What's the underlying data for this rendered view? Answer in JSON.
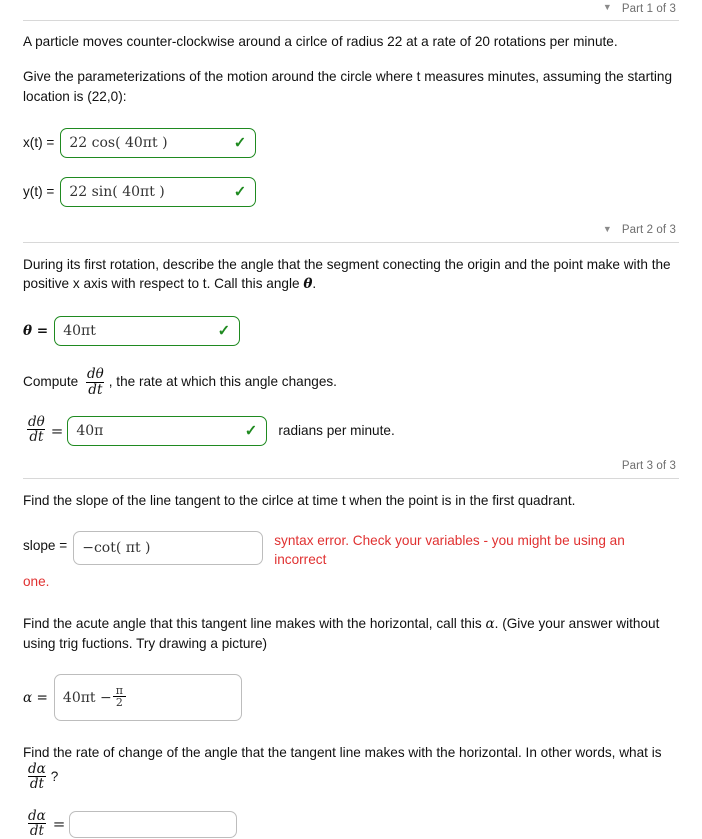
{
  "parts": {
    "part1": {
      "caret": "▼",
      "label": "Part 1 of 3"
    },
    "part2": {
      "caret": "▼",
      "label": "Part 2 of 3"
    },
    "part3": {
      "label": "Part 3 of 3"
    }
  },
  "section1": {
    "intro": "A particle moves counter-clockwise around a cirlce of radius 22 at a rate of 20 rotations per minute.",
    "instruction": "Give the parameterizations of the motion around the circle where t measures minutes, assuming the starting location is (22,0):",
    "x_label": "x(t) =",
    "x_value": "22 cos( 40πt )",
    "x_status": "✓",
    "y_label": "y(t) =",
    "y_value": "22 sin( 40πt )",
    "y_status": "✓"
  },
  "section2": {
    "prompt_a": "During its first rotation, describe the angle that the segment conecting the origin and the point make with the positive x axis with respect to t. Call this angle",
    "prompt_a_symbol": "θ",
    "prompt_a_end": ".",
    "theta_label": "θ =",
    "theta_value": "40πt",
    "theta_status": "✓",
    "compute_pre": "Compute",
    "compute_frac_num": "dθ",
    "compute_frac_den": "dt",
    "compute_post": ", the rate at which this angle changes.",
    "dtheta_num": "dθ",
    "dtheta_den": "dt",
    "dtheta_value": "40π",
    "dtheta_status": "✓",
    "dtheta_unit": "radians per minute."
  },
  "section3": {
    "slope_prompt": "Find the slope of the line tangent to the cirlce at time t when the point is in the first quadrant.",
    "slope_label": "slope =",
    "slope_value": "−cot( πt )",
    "slope_error": "syntax error. Check your variables - you might be using an incorrect",
    "slope_error_cont": "one.",
    "alpha_prompt_a": "Find the acute angle that this tangent line makes with the horizontal, call this",
    "alpha_prompt_symbol": "α",
    "alpha_prompt_b": ". (Give your answer without using trig fuctions. Try drawing a picture)",
    "alpha_label": "α =",
    "alpha_value_main": "40πt −",
    "alpha_frac_num": "π",
    "alpha_frac_den": "2",
    "rate_prompt_a": "Find the rate of change of the angle that the tangent line makes with the horizontal. In other words, what is",
    "rate_frac_num": "dα",
    "rate_frac_den": "dt",
    "rate_prompt_b": "?",
    "dalpha_num": "dα",
    "dalpha_den": "dt",
    "dalpha_value": ""
  },
  "colors": {
    "ok_green": "#1f8a20",
    "error_red": "#e03131",
    "border_gray": "#bdbdbd"
  }
}
